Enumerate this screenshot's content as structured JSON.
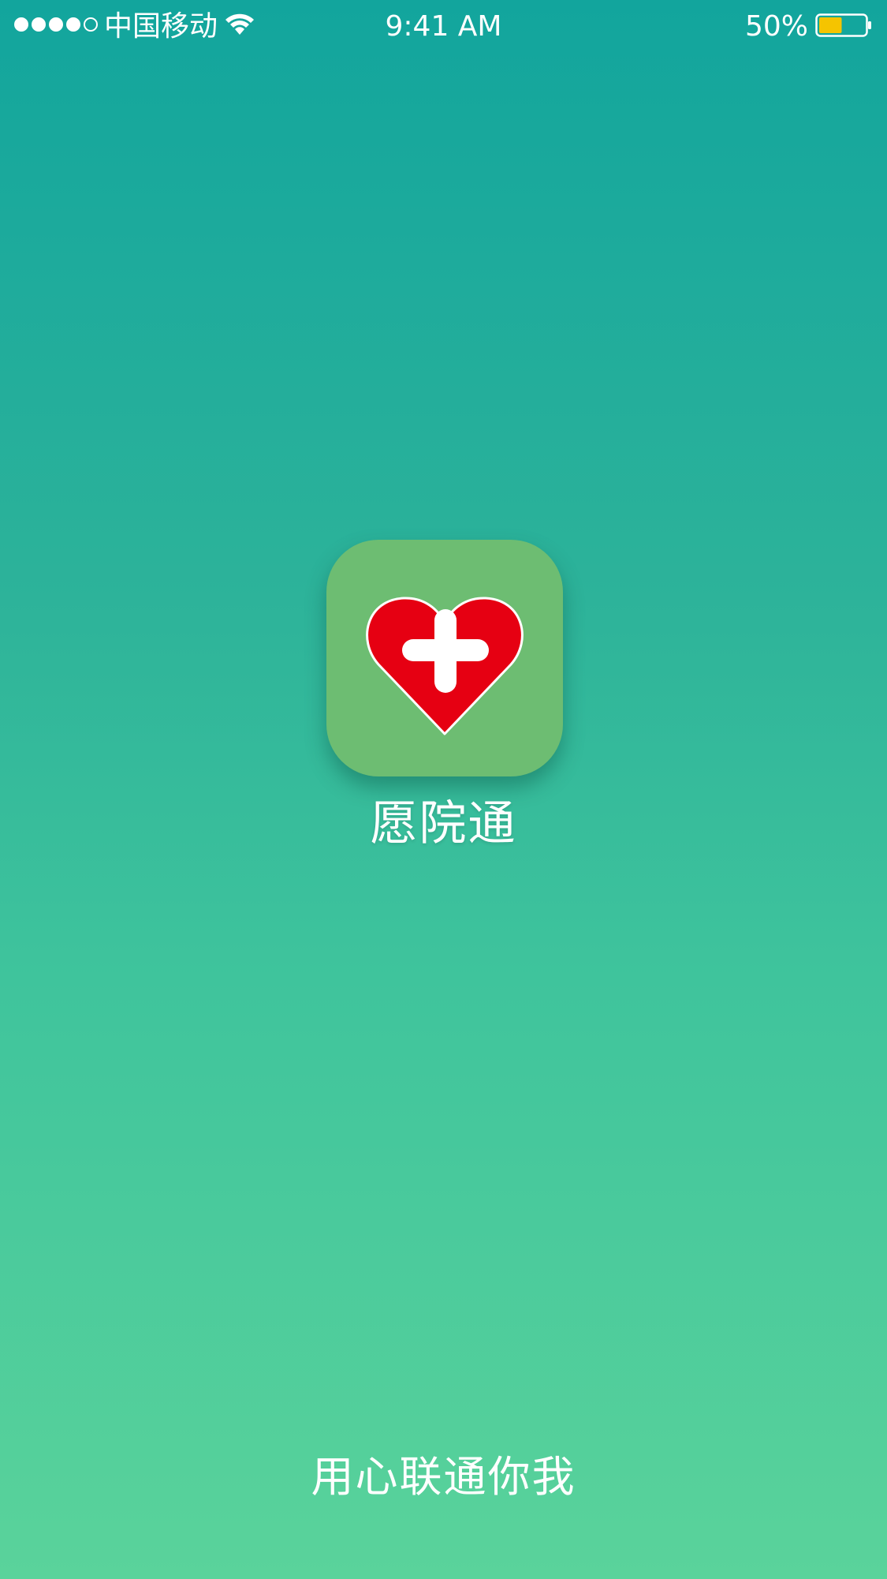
{
  "status_bar": {
    "signal_strength": {
      "filled": 4,
      "total": 5
    },
    "carrier": "中国移动",
    "wifi_icon": "wifi-icon",
    "time": "9:41 AM",
    "battery_percent": "50%",
    "battery_level": 0.5,
    "battery_color": "#f5c400"
  },
  "splash": {
    "app_icon": "heart-plus-icon",
    "icon_bg_color": "#6dbd72",
    "heart_color": "#e60012",
    "app_name": "愿院通",
    "slogan": "用心联通你我"
  },
  "colors": {
    "gradient_top": "#12a59d",
    "gradient_bottom": "#5ad39b"
  }
}
